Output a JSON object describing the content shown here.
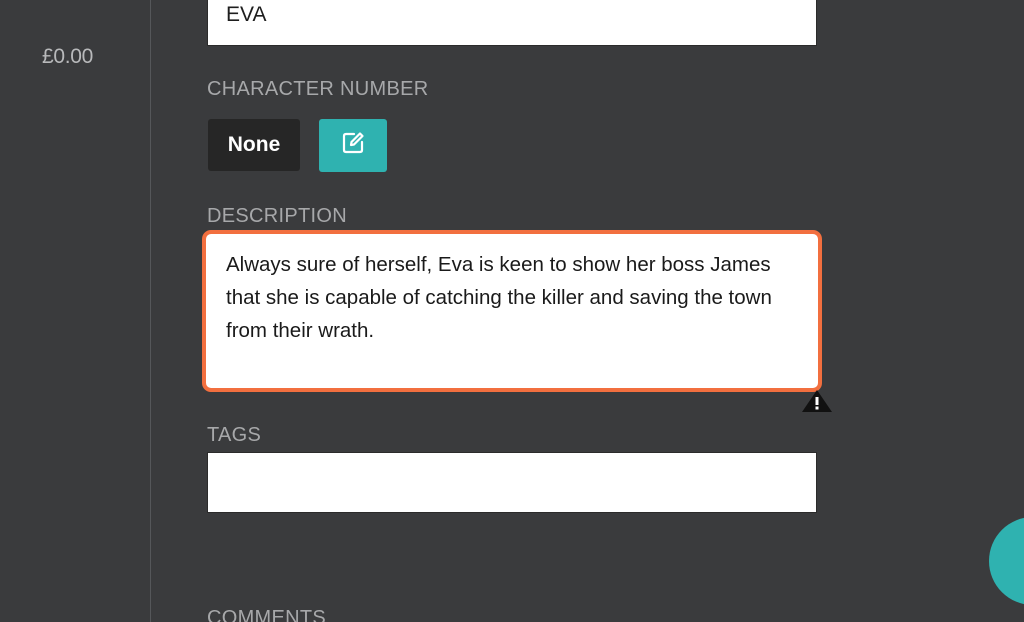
{
  "sidebar": {
    "price": "£0.00"
  },
  "form": {
    "name_value": "EVA",
    "character_number_label": "CHARACTER NUMBER",
    "character_number_value": "None",
    "description_label": "DESCRIPTION",
    "description_value": "Always sure of herself, Eva is keen to show her boss James that she is capable of catching the killer and saving the town from their wrath.",
    "tags_label": "TAGS",
    "tags_value": "",
    "comments_label": "COMMENTS"
  },
  "icons": {
    "edit": "edit-icon",
    "resize": "warning-resize-icon",
    "fab": "action-fab"
  },
  "colors": {
    "accent": "#2fb2b0",
    "highlight": "#f26f3f",
    "background": "#3a3b3d"
  }
}
